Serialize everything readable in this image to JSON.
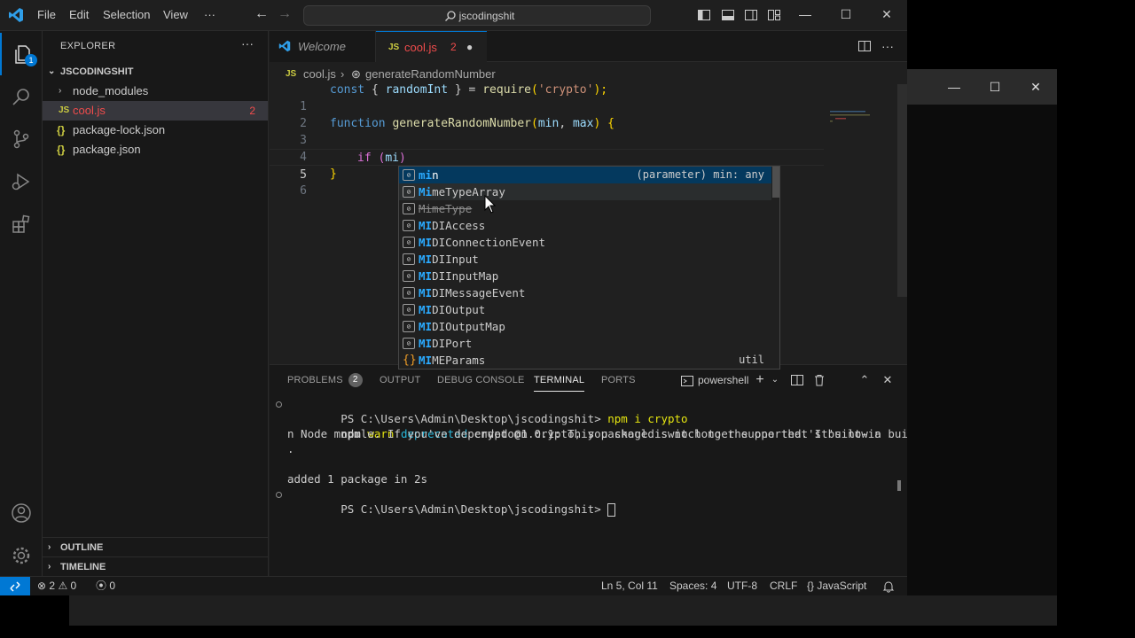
{
  "titlebar": {
    "menu": [
      "File",
      "Edit",
      "Selection",
      "View",
      "···"
    ],
    "search_label": "jscodingshit"
  },
  "activity": {
    "explorer_badge": "1"
  },
  "sidebar": {
    "title": "EXPLORER",
    "more": "···",
    "root": "JSCODINGSHIT",
    "items": [
      {
        "label": "node_modules",
        "kind": "folder"
      },
      {
        "label": "cool.js",
        "kind": "js",
        "errors": "2"
      },
      {
        "label": "package-lock.json",
        "kind": "json"
      },
      {
        "label": "package.json",
        "kind": "json"
      }
    ],
    "outline": "OUTLINE",
    "timeline": "TIMELINE"
  },
  "tabs": [
    {
      "label": "Welcome"
    },
    {
      "label": "cool.js",
      "problems": "2",
      "dirty": "●"
    }
  ],
  "breadcrumb": {
    "file": "cool.js",
    "symbol": "generateRandomNumber"
  },
  "code": {
    "line_numbers": [
      "1",
      "2",
      "3",
      "4",
      "5",
      "6"
    ],
    "l1": {
      "k": "const",
      "b1": " { ",
      "v": "randomInt",
      "b2": " } = ",
      "fn": "require",
      "o": "(",
      "s": "'crypto'",
      "c": ");"
    },
    "l3": {
      "k": "function",
      "fn": " generateRandomNumber",
      "o": "(",
      "a1": "min",
      "comma": ", ",
      "a2": "max",
      "c": ")",
      "brace": " {"
    },
    "l5": {
      "k": "if",
      "o": " (",
      "typed": "mi",
      "c": ")"
    },
    "l6": {
      "brace": "}"
    }
  },
  "suggest": {
    "items": [
      {
        "match": "mi",
        "rest": "n",
        "detail": "(parameter) min: any"
      },
      {
        "match": "Mi",
        "rest": "meTypeArray"
      },
      {
        "match": "",
        "rest": "MimeType",
        "deprecated": true
      },
      {
        "match": "MI",
        "rest": "DIAccess"
      },
      {
        "match": "MI",
        "rest": "DIConnectionEvent"
      },
      {
        "match": "MI",
        "rest": "DIInput"
      },
      {
        "match": "MI",
        "rest": "DIInputMap"
      },
      {
        "match": "MI",
        "rest": "DIMessageEvent"
      },
      {
        "match": "MI",
        "rest": "DIOutput"
      },
      {
        "match": "MI",
        "rest": "DIOutputMap"
      },
      {
        "match": "MI",
        "rest": "DIPort"
      },
      {
        "match": "MI",
        "rest": "MEParams",
        "detail": "util"
      }
    ],
    "var_icon": "[⊘]"
  },
  "panel": {
    "tabs": {
      "problems": "PROBLEMS",
      "problems_count": "2",
      "output": "OUTPUT",
      "debug": "DEBUG CONSOLE",
      "terminal": "TERMINAL",
      "ports": "PORTS"
    },
    "shell": "powershell"
  },
  "terminal": {
    "l1_prompt": "PS C:\\Users\\Admin\\Desktop\\jscodingshit> ",
    "l1_cmd": "npm i crypto",
    "l2_npm": "npm ",
    "l2_warn": "warn",
    "l2_dep": " deprecated",
    "l2_rest": " crypto@1.0.1: This package is no longer supported. It's now a built-i",
    "l3": "n Node module. If you've depended on crypto, you should switch to the one that's built-in",
    "l4": ".",
    "l5": "",
    "l6": "added 1 package in 2s",
    "l7_prompt": "PS C:\\Users\\Admin\\Desktop\\jscodingshit> "
  },
  "status": {
    "errors": "2",
    "warnings": "0",
    "ports": "0",
    "position": "Ln 5, Col 11",
    "spaces": "Spaces: 4",
    "encoding": "UTF-8",
    "eol": "CRLF",
    "language": "{} JavaScript"
  },
  "colors": {
    "accent": "#0078d4",
    "editor_bg": "#1f1f1f",
    "sidebar_bg": "#181818",
    "error": "#f14c4c",
    "js_icon": "#cbcb41"
  }
}
